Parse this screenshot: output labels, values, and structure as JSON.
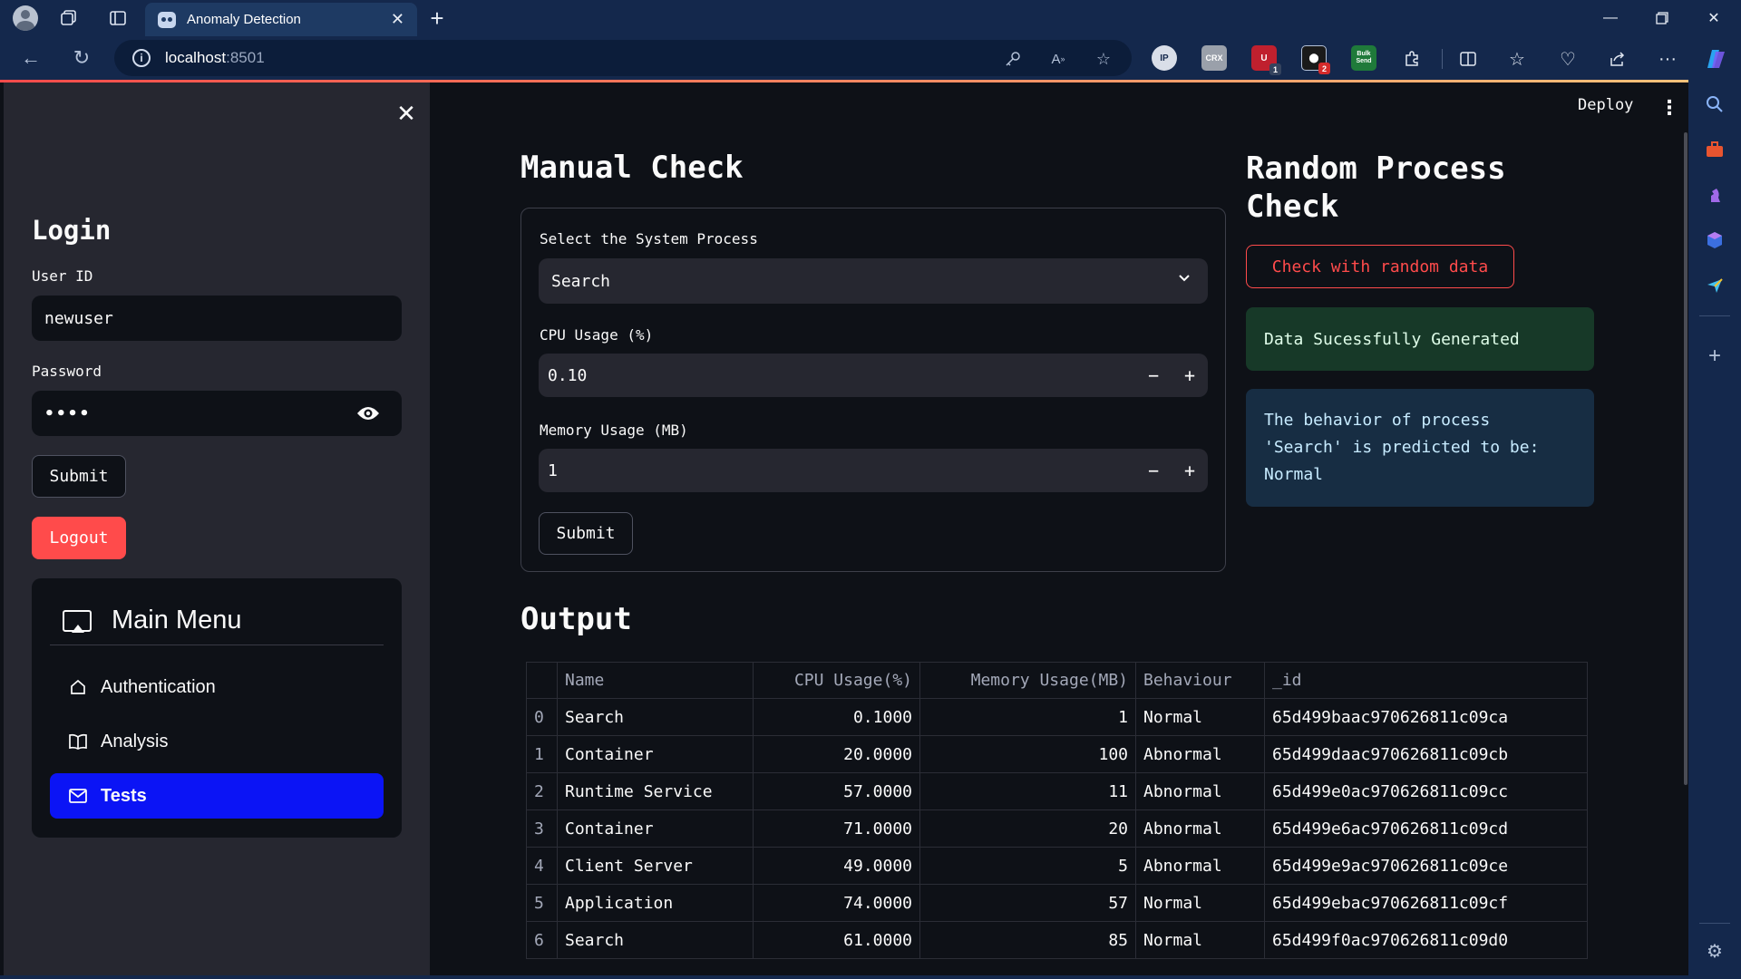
{
  "browser": {
    "tab_title": "Anomaly Detection",
    "url_host": "localhost",
    "url_port": ":8501",
    "window_controls": [
      "minimize-icon",
      "restore-icon",
      "close-icon"
    ],
    "extensions": [
      {
        "name": "ip-extension-icon",
        "label": "IP",
        "color": "#d9dee8"
      },
      {
        "name": "crx-extension-icon",
        "label": "CRX",
        "color": "#9aa0aa"
      },
      {
        "name": "ublock-extension-icon",
        "label": "U",
        "color": "#c0202e",
        "badge": "1"
      },
      {
        "name": "extension-with-badge-icon",
        "label": "",
        "color": "#1a1a1a",
        "badge": "2"
      },
      {
        "name": "bulk-send-extension-icon",
        "label": "Bulk Send",
        "color": "#1f7a3a"
      }
    ]
  },
  "app_header": {
    "deploy_label": "Deploy",
    "menu_glyph": "⋮"
  },
  "sidebar": {
    "close_glyph": "✕",
    "login_title": "Login",
    "user_id_label": "User ID",
    "user_id_value": "newuser",
    "password_label": "Password",
    "password_value": "••••",
    "submit_label": "Submit",
    "logout_label": "Logout",
    "menu": {
      "title": "Main Menu",
      "items": [
        {
          "label": "Authentication",
          "icon": "house-icon",
          "active": false
        },
        {
          "label": "Analysis",
          "icon": "book-icon",
          "active": false
        },
        {
          "label": "Tests",
          "icon": "envelope-icon",
          "active": true
        }
      ]
    }
  },
  "manual_check": {
    "title": "Manual Check",
    "process_label": "Select the System Process",
    "process_value": "Search",
    "cpu_label": "CPU Usage (%)",
    "cpu_value": "0.10",
    "memory_label": "Memory Usage (MB)",
    "memory_value": "1",
    "minus": "−",
    "plus": "+",
    "submit_label": "Submit"
  },
  "random_check": {
    "title": "Random Process Check",
    "button_label": "Check with random data",
    "success_message": "Data Sucessfully Generated",
    "info_message_line1": "The behavior of process",
    "info_message_line2": "'Search' is predicted to be:",
    "info_message_line3": "Normal"
  },
  "output": {
    "title": "Output",
    "columns": [
      "",
      "Name",
      "CPU Usage(%)",
      "Memory Usage(MB)",
      "Behaviour",
      "_id"
    ],
    "rows": [
      [
        "0",
        "Search",
        "0.1000",
        "1",
        "Normal",
        "65d499baac970626811c09ca"
      ],
      [
        "1",
        "Container",
        "20.0000",
        "100",
        "Abnormal",
        "65d499daac970626811c09cb"
      ],
      [
        "2",
        "Runtime Service",
        "57.0000",
        "11",
        "Abnormal",
        "65d499e0ac970626811c09cc"
      ],
      [
        "3",
        "Container",
        "71.0000",
        "20",
        "Abnormal",
        "65d499e6ac970626811c09cd"
      ],
      [
        "4",
        "Client Server",
        "49.0000",
        "5",
        "Abnormal",
        "65d499e9ac970626811c09ce"
      ],
      [
        "5",
        "Application",
        "74.0000",
        "57",
        "Normal",
        "65d499ebac970626811c09cf"
      ],
      [
        "6",
        "Search",
        "61.0000",
        "85",
        "Normal",
        "65d499f0ac970626811c09d0"
      ]
    ]
  },
  "colors": {
    "primary": "#ff4b4b",
    "menu_active": "#0b14f5",
    "success_bg": "#173928",
    "info_bg": "#172d43",
    "app_bg": "#0e1117",
    "sidebar_bg": "#262730",
    "browser_frame": "#14284c"
  }
}
